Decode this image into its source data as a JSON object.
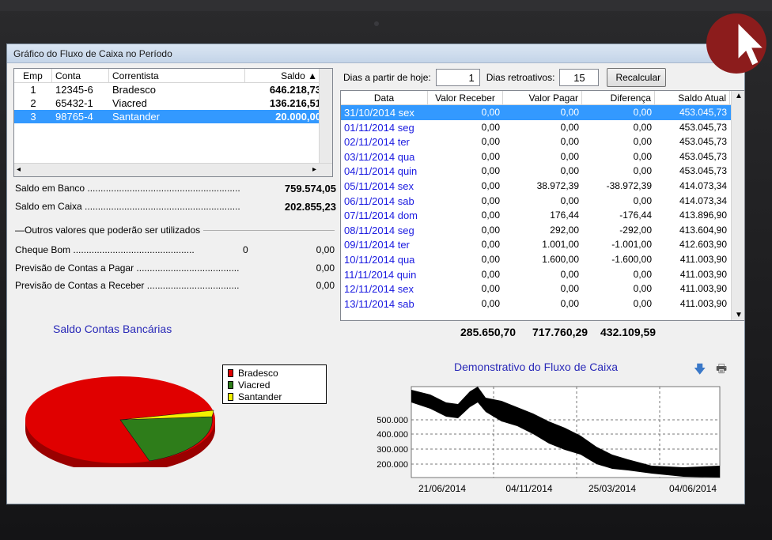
{
  "window": {
    "title": "Gráfico do Fluxo de Caixa no Período"
  },
  "accounts": {
    "headers": [
      "Emp",
      "Conta",
      "Correntista",
      "Saldo"
    ],
    "rows": [
      {
        "emp": "1",
        "conta": "12345-6",
        "correntista": "Bradesco",
        "saldo": "646.218,73"
      },
      {
        "emp": "2",
        "conta": "65432-1",
        "correntista": "Viacred",
        "saldo": "136.216,51"
      },
      {
        "emp": "3",
        "conta": "98765-4",
        "correntista": "Santander",
        "saldo": "20.000,00"
      }
    ]
  },
  "summary": {
    "saldo_banco_label": "Saldo em Banco ..........................................................",
    "saldo_banco_value": "759.574,05",
    "saldo_caixa_label": "Saldo em Caixa ...........................................................",
    "saldo_caixa_value": "202.855,23",
    "outros_label": "Outros valores que poderão ser utilizados",
    "cheque_label": "Cheque Bom ..............................................",
    "cheque_count": "0",
    "cheque_value": "0,00",
    "prev_pagar_label": "Previsão de Contas a Pagar .......................................",
    "prev_pagar_value": "0,00",
    "prev_receber_label": "Previsão de Contas a Receber ...................................",
    "prev_receber_value": "0,00"
  },
  "pie": {
    "title": "Saldo Contas Bancárias",
    "legend": [
      {
        "name": "Bradesco",
        "color": "#e00000"
      },
      {
        "name": "Viacred",
        "color": "#2e7d1a"
      },
      {
        "name": "Santander",
        "color": "#f2f200"
      }
    ]
  },
  "controls": {
    "dias_hoje_label": "Dias a partir de hoje:",
    "dias_hoje_value": "1",
    "dias_retro_label": "Dias retroativos:",
    "dias_retro_value": "15",
    "recalc_label": "Recalcular"
  },
  "flow": {
    "headers": [
      "Data",
      "Valor Receber",
      "Valor Pagar",
      "Diferença",
      "Saldo Atual"
    ],
    "rows": [
      {
        "data": "31/10/2014 sex",
        "receber": "0,00",
        "pagar": "0,00",
        "dif": "0,00",
        "saldo": "453.045,73"
      },
      {
        "data": "01/11/2014 seg",
        "receber": "0,00",
        "pagar": "0,00",
        "dif": "0,00",
        "saldo": "453.045,73"
      },
      {
        "data": "02/11/2014 ter",
        "receber": "0,00",
        "pagar": "0,00",
        "dif": "0,00",
        "saldo": "453.045,73"
      },
      {
        "data": "03/11/2014 qua",
        "receber": "0,00",
        "pagar": "0,00",
        "dif": "0,00",
        "saldo": "453.045,73"
      },
      {
        "data": "04/11/2014 quin",
        "receber": "0,00",
        "pagar": "0,00",
        "dif": "0,00",
        "saldo": "453.045,73"
      },
      {
        "data": "05/11/2014 sex",
        "receber": "0,00",
        "pagar": "38.972,39",
        "dif": "-38.972,39",
        "saldo": "414.073,34"
      },
      {
        "data": "06/11/2014 sab",
        "receber": "0,00",
        "pagar": "0,00",
        "dif": "0,00",
        "saldo": "414.073,34"
      },
      {
        "data": "07/11/2014 dom",
        "receber": "0,00",
        "pagar": "176,44",
        "dif": "-176,44",
        "saldo": "413.896,90"
      },
      {
        "data": "08/11/2014 seg",
        "receber": "0,00",
        "pagar": "292,00",
        "dif": "-292,00",
        "saldo": "413.604,90"
      },
      {
        "data": "09/11/2014 ter",
        "receber": "0,00",
        "pagar": "1.001,00",
        "dif": "-1.001,00",
        "saldo": "412.603,90"
      },
      {
        "data": "10/11/2014 qua",
        "receber": "0,00",
        "pagar": "1.600,00",
        "dif": "-1.600,00",
        "saldo": "411.003,90"
      },
      {
        "data": "11/11/2014 quin",
        "receber": "0,00",
        "pagar": "0,00",
        "dif": "0,00",
        "saldo": "411.003,90"
      },
      {
        "data": "12/11/2014 sex",
        "receber": "0,00",
        "pagar": "0,00",
        "dif": "0,00",
        "saldo": "411.003,90"
      },
      {
        "data": "13/11/2014 sab",
        "receber": "0,00",
        "pagar": "0,00",
        "dif": "0,00",
        "saldo": "411.003,90"
      }
    ],
    "totals": {
      "receber": "285.650,70",
      "pagar": "717.760,29",
      "dif": "432.109,59"
    }
  },
  "line_chart": {
    "title": "Demonstrativo do Fluxo de Caixa",
    "y_ticks": [
      "500.000",
      "400.000",
      "300.000",
      "200.000"
    ],
    "x_ticks": [
      "21/06/2014",
      "04/11/2014",
      "25/03/2014",
      "04/06/2014"
    ]
  },
  "chart_data": {
    "type": "pie",
    "title": "Saldo Contas Bancárias",
    "categories": [
      "Bradesco",
      "Viacred",
      "Santander"
    ],
    "values": [
      646218.73,
      136216.51,
      20000.0
    ]
  }
}
